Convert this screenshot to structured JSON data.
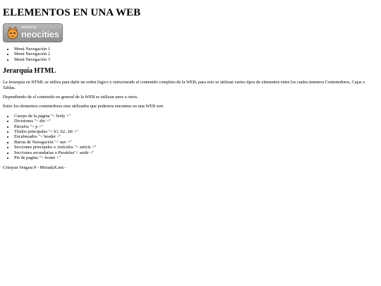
{
  "page": {
    "title": "ELEMENTOS EN UNA WEB"
  },
  "badge": {
    "hosted_text": "hosted by",
    "brand_text": "neocities",
    "icon": "neocities-cat-icon"
  },
  "nav": {
    "items": [
      {
        "label": "Menú Navegación 1"
      },
      {
        "label": "Menú Navegación 2"
      },
      {
        "label": "Menú Navegación 3"
      }
    ]
  },
  "section": {
    "heading": "Jerarquía HTML",
    "paragraphs": [
      "La Jerarquía en HTML se utiliza para darle un orden lógico y estructurado al contenido completo de la WEB, para esto se utilizan varios tipos de elementos entre los cuales tenemos Contenedores, Cajas o Tablas.",
      "Dependiendo de el contenido en general de la WEB se utilizan unos u otros.",
      "Entre los elementos contenedores mas utilizados que podemos encontrar en una WEB son:"
    ],
    "elements": [
      {
        "label": "Cuerpo de la página \"< body >\""
      },
      {
        "label": "Divisiones \"< div >\""
      },
      {
        "label": "Párrafos \"< p >\""
      },
      {
        "label": "Títulos principales \"< h1, h2...h6 >\""
      },
      {
        "label": "Encabezados \"< header >\""
      },
      {
        "label": "Barras de Navegación \"< nav >\""
      },
      {
        "label": "Secciones principales o Artículos \"< article >\""
      },
      {
        "label": "Secciones secundarias o Paralelas\"< aside >\""
      },
      {
        "label": "Pie de pagina \"< footer >\""
      }
    ]
  },
  "footer": {
    "text": "Cristyan Vergara P - MiriadaX.net -"
  }
}
